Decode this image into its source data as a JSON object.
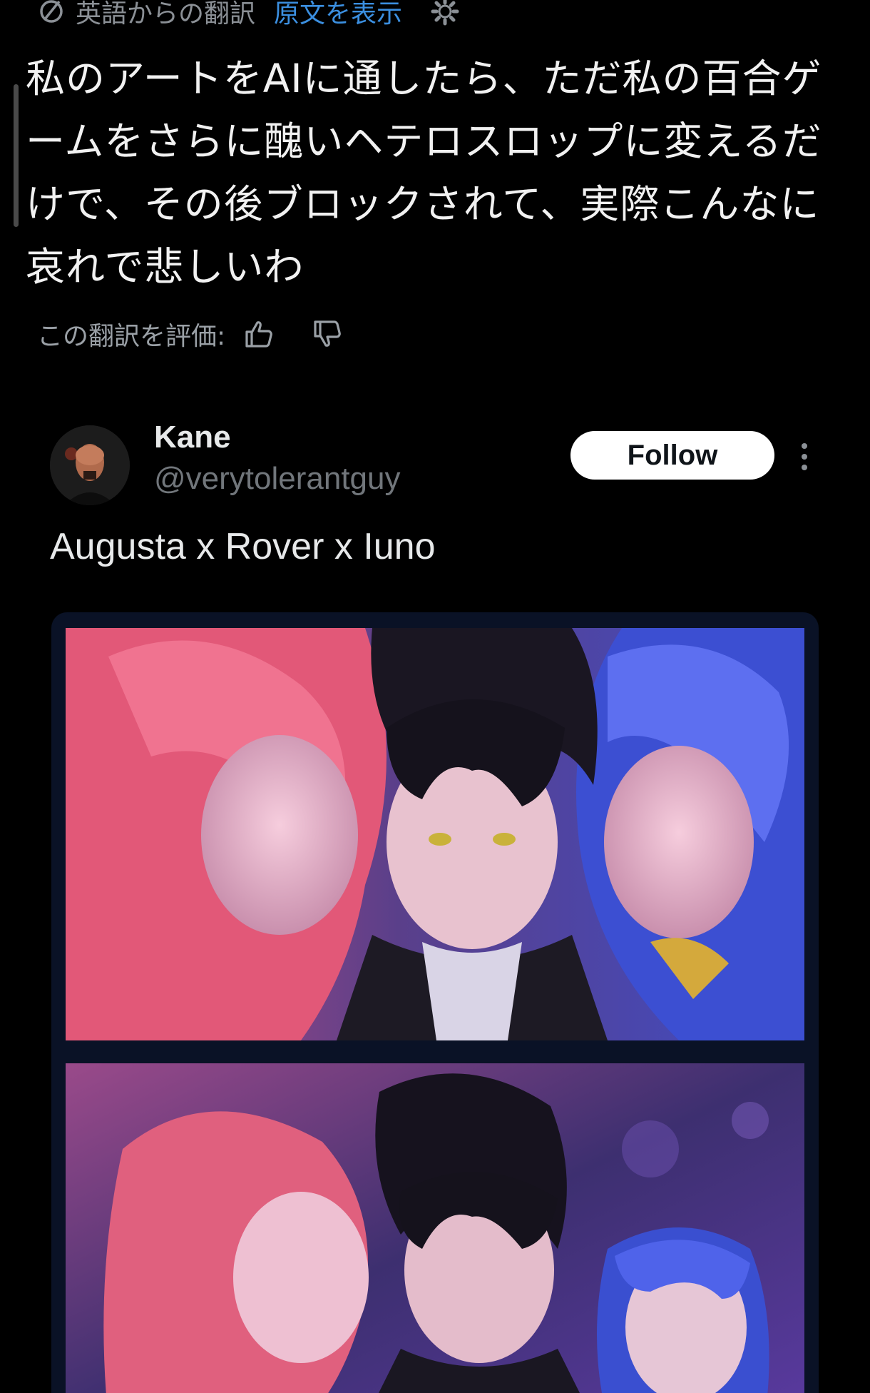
{
  "translation": {
    "header_label": "英語からの翻訳",
    "show_original_label": "原文を表示",
    "translated_text": "私のアートをAIに通したら、ただ私の百合ゲームをさらに醜いヘテロスロップに変えるだけで、その後ブロックされて、実際こんなに哀れで悲しいわ",
    "rate_label": "この翻訳を評価:"
  },
  "embedded_post": {
    "author": {
      "display_name": "Kane",
      "handle": "@verytolerantguy"
    },
    "follow_label": "Follow",
    "text": "Augusta x Rover x Iuno"
  },
  "icons": {
    "translate": "translate-icon",
    "gear": "gear-icon",
    "thumbs_up": "thumbs-up-icon",
    "thumbs_down": "thumbs-down-icon",
    "more": "more-vertical-icon"
  },
  "colors": {
    "background": "#000000",
    "link": "#3b8fe0",
    "muted": "#71767b",
    "follow_bg": "#ffffff"
  }
}
